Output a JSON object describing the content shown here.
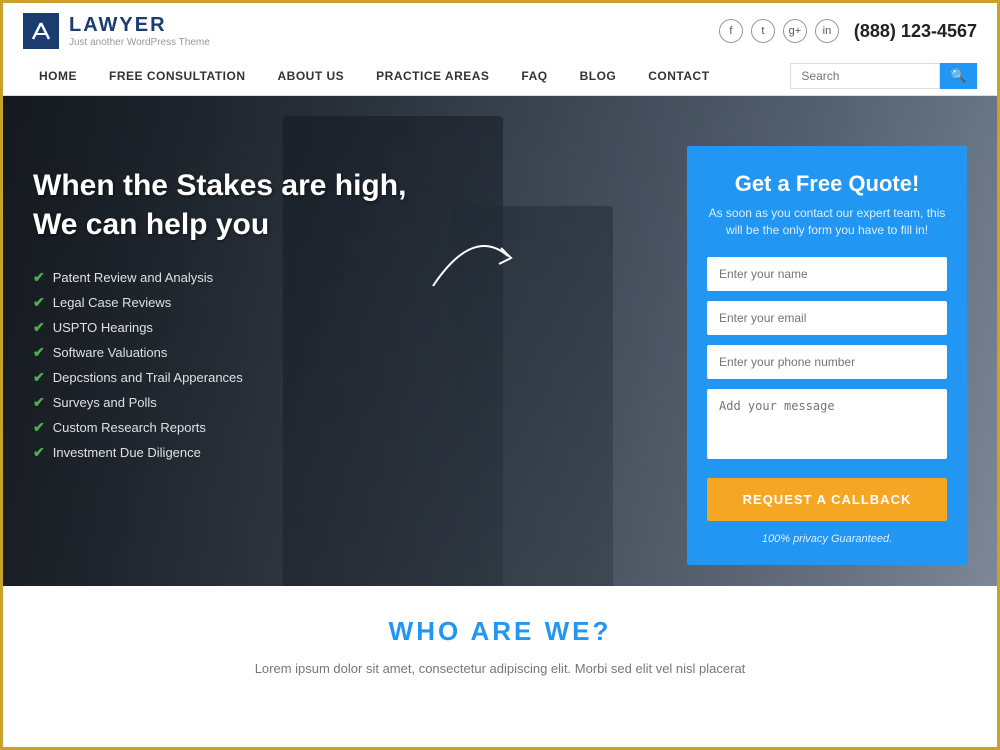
{
  "header": {
    "logo_title": "LAWYER",
    "logo_subtitle": "Just another WordPress Theme",
    "phone": "(888) 123-4567",
    "social": [
      "f",
      "t",
      "g+",
      "in"
    ],
    "nav_items": [
      "HOME",
      "FREE CONSULTATION",
      "ABOUT US",
      "PRACTICE AREAS",
      "FAQ",
      "BLOG",
      "CONTACT"
    ],
    "search_placeholder": "Search"
  },
  "hero": {
    "title_line1": "When the Stakes are high,",
    "title_line2": "We can help you",
    "checklist": [
      "Patent Review and Analysis",
      "Legal Case Reviews",
      "USPTO Hearings",
      "Software Valuations",
      "Depcstions and Trail Apperances",
      "Surveys and Polls",
      "Custom Research Reports",
      "Investment Due Diligence"
    ]
  },
  "quote_form": {
    "title": "Get a Free Quote!",
    "subtitle": "As soon as you contact our expert team, this will be the only form you have to fill in!",
    "name_placeholder": "Enter your name",
    "email_placeholder": "Enter your email",
    "phone_placeholder": "Enter your phone number",
    "message_placeholder": "Add your message",
    "button_label": "REQUEST A CALLBACK",
    "privacy_text": "100% privacy Guaranteed."
  },
  "who_section": {
    "title": "WHO ARE WE?",
    "body": "Lorem ipsum dolor sit amet, consectetur adipiscing elit. Morbi sed elit vel nisl placerat"
  },
  "icons": {
    "search": "🔍",
    "check": "✔"
  }
}
